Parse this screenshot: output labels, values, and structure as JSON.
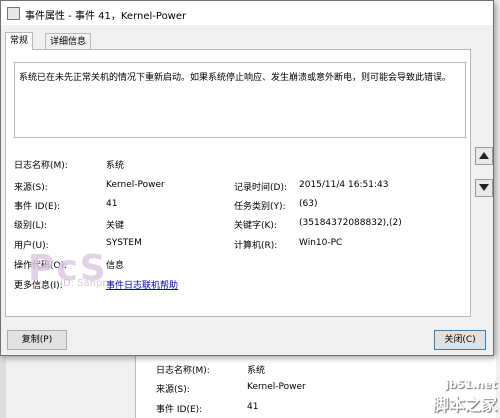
{
  "window": {
    "title": "事件属性 - 事件 41，Kernel-Power"
  },
  "tabs": [
    {
      "label": "常规"
    },
    {
      "label": "详细信息"
    }
  ],
  "description": "系统已在未先正常关机的情况下重新启动。如果系统停止响应、发生崩溃或意外断电，则可能会导致此错误。",
  "left_fields": [
    {
      "label": "日志名称(M):",
      "value": "系统"
    },
    {
      "label": "来源(S):",
      "value": "Kernel-Power"
    },
    {
      "label": "事件 ID(E):",
      "value": "41"
    },
    {
      "label": "级别(L):",
      "value": "关键"
    },
    {
      "label": "用户(U):",
      "value": "SYSTEM"
    },
    {
      "label": "操作代码(O):",
      "value": "信息"
    },
    {
      "label": "更多信息(I):",
      "value": "事件日志联机帮助"
    }
  ],
  "right_fields": [
    {
      "label": "记录时间(D):",
      "value": "2015/11/4 16:51:43"
    },
    {
      "label": "任务类别(Y):",
      "value": "(63)"
    },
    {
      "label": "关键字(K):",
      "value": "(35184372088832),(2)"
    },
    {
      "label": "计算机(R):",
      "value": "Win10-PC"
    }
  ],
  "buttons": {
    "copy": "复制(P)",
    "close": "关闭(C)"
  },
  "background_panel": [
    {
      "label": "日志名称(M):",
      "value": "系统"
    },
    {
      "label": "来源(S):",
      "value": "Kernel-Power"
    },
    {
      "label": "事件 ID(E):",
      "value": "41"
    }
  ],
  "watermark": {
    "logo": "PcS",
    "text": "ID: Sanpr"
  },
  "site_mark": {
    "top": "jb51.net",
    "bottom": "脚本之家"
  }
}
